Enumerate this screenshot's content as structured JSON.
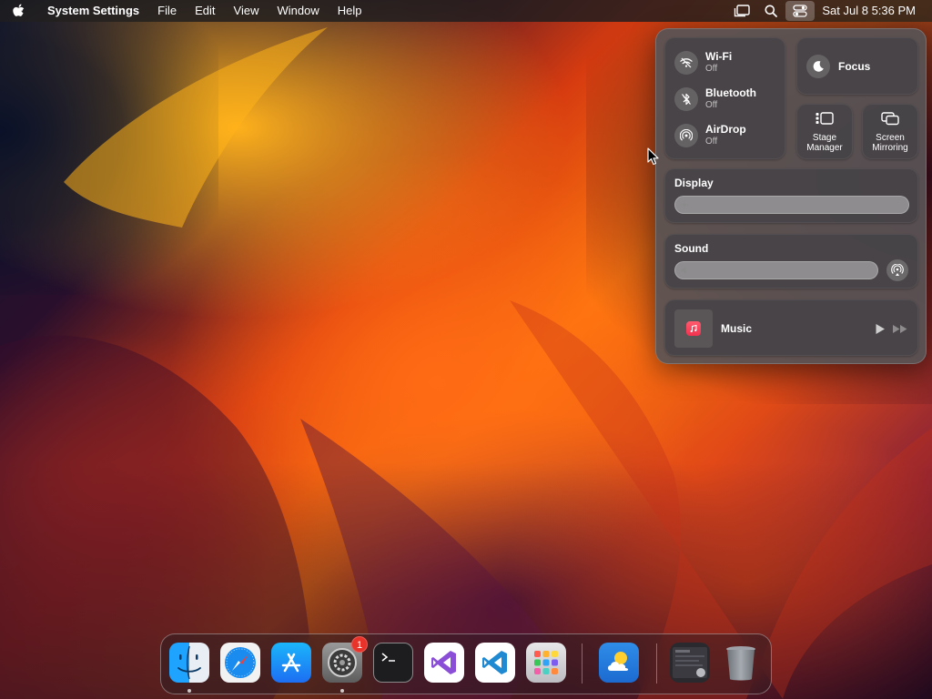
{
  "menubar": {
    "app_name": "System Settings",
    "menus": [
      "File",
      "Edit",
      "View",
      "Window",
      "Help"
    ],
    "clock": "Sat Jul 8  5:36 PM"
  },
  "control_center": {
    "wifi": {
      "label": "Wi-Fi",
      "status": "Off"
    },
    "bluetooth": {
      "label": "Bluetooth",
      "status": "Off"
    },
    "airdrop": {
      "label": "AirDrop",
      "status": "Off"
    },
    "focus": {
      "label": "Focus"
    },
    "stage_manager": {
      "line1": "Stage",
      "line2": "Manager"
    },
    "screen_mirroring": {
      "line1": "Screen",
      "line2": "Mirroring"
    },
    "display": {
      "label": "Display"
    },
    "sound": {
      "label": "Sound"
    },
    "music": {
      "label": "Music"
    }
  },
  "dock": {
    "items": [
      {
        "name": "Finder",
        "icon": "finder-icon",
        "running": true
      },
      {
        "name": "Safari",
        "icon": "safari-icon",
        "running": false
      },
      {
        "name": "App Store",
        "icon": "app-store-icon",
        "running": false
      },
      {
        "name": "System Settings",
        "icon": "system-settings-icon",
        "running": true,
        "badge": "1"
      },
      {
        "name": "Terminal",
        "icon": "terminal-icon",
        "running": false
      },
      {
        "name": "Visual Studio",
        "icon": "visual-studio-icon",
        "running": false
      },
      {
        "name": "Visual Studio Code",
        "icon": "vscode-icon",
        "running": false
      },
      {
        "name": "Launchpad",
        "icon": "launchpad-icon",
        "running": false
      },
      {
        "name": "Weather",
        "icon": "weather-icon",
        "running": false
      },
      {
        "name": "Downloads",
        "icon": "downloads-stack-icon",
        "running": false
      },
      {
        "name": "Trash",
        "icon": "trash-icon",
        "running": false
      }
    ]
  },
  "colors": {
    "control_center_bg": "#585456",
    "tile_bg": "#464346",
    "badge": "#e8332a",
    "music_accent": "#f2324f",
    "vscode_blue": "#1f8ad2",
    "visual_studio_purple": "#8a4fd6"
  }
}
